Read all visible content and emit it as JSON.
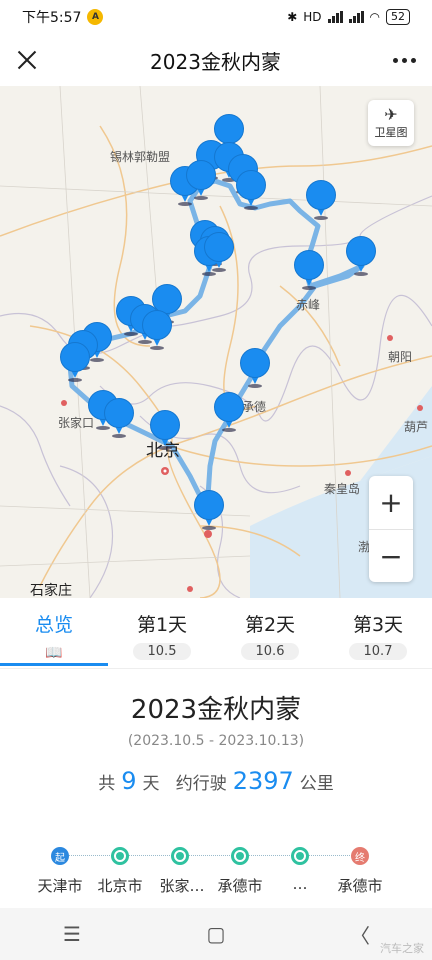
{
  "status": {
    "time": "下午5:57",
    "app_badge": "A",
    "network": "HD",
    "wifi": "wifi",
    "battery": "52"
  },
  "nav": {
    "title": "2023金秋内蒙"
  },
  "map": {
    "satellite_label": "卫星图",
    "zoom_in": "+",
    "zoom_out": "−",
    "labels": {
      "xilin": "锡林郭勒盟",
      "chifeng": "赤峰",
      "chaoyang": "朝阳",
      "zhangjiakou": "张家口",
      "chengde": "承德",
      "beijing": "北京",
      "qinhuangdao": "秦皇岛",
      "huludao": "葫芦",
      "shijiazhuang": "石家庄",
      "bohai": "渤"
    }
  },
  "tabs": [
    {
      "label": "总览",
      "active": true
    },
    {
      "label": "第1天",
      "date": "10.5"
    },
    {
      "label": "第2天",
      "date": "10.6"
    },
    {
      "label": "第3天",
      "date": "10.7"
    }
  ],
  "summary": {
    "title": "2023金秋内蒙",
    "date_range": "(2023.10.5 - 2023.10.13)",
    "days_prefix": "共",
    "days": "9",
    "days_suffix": "天",
    "distance_prefix": "约行驶",
    "distance": "2397",
    "distance_unit": "公里"
  },
  "route": {
    "start_mark": "起",
    "end_mark": "终",
    "stops": [
      "天津市",
      "北京市",
      "张家…",
      "承德市",
      "…",
      "承德市"
    ]
  },
  "sys_nav": {
    "menu": "☰",
    "home": "▢",
    "back": "〈"
  },
  "watermark": "汽车之家",
  "colors": {
    "accent": "#1a8cf0",
    "route": "#7ab4e6",
    "start": "#2b88df",
    "end": "#e57b70",
    "stop": "#2fc2a0"
  }
}
